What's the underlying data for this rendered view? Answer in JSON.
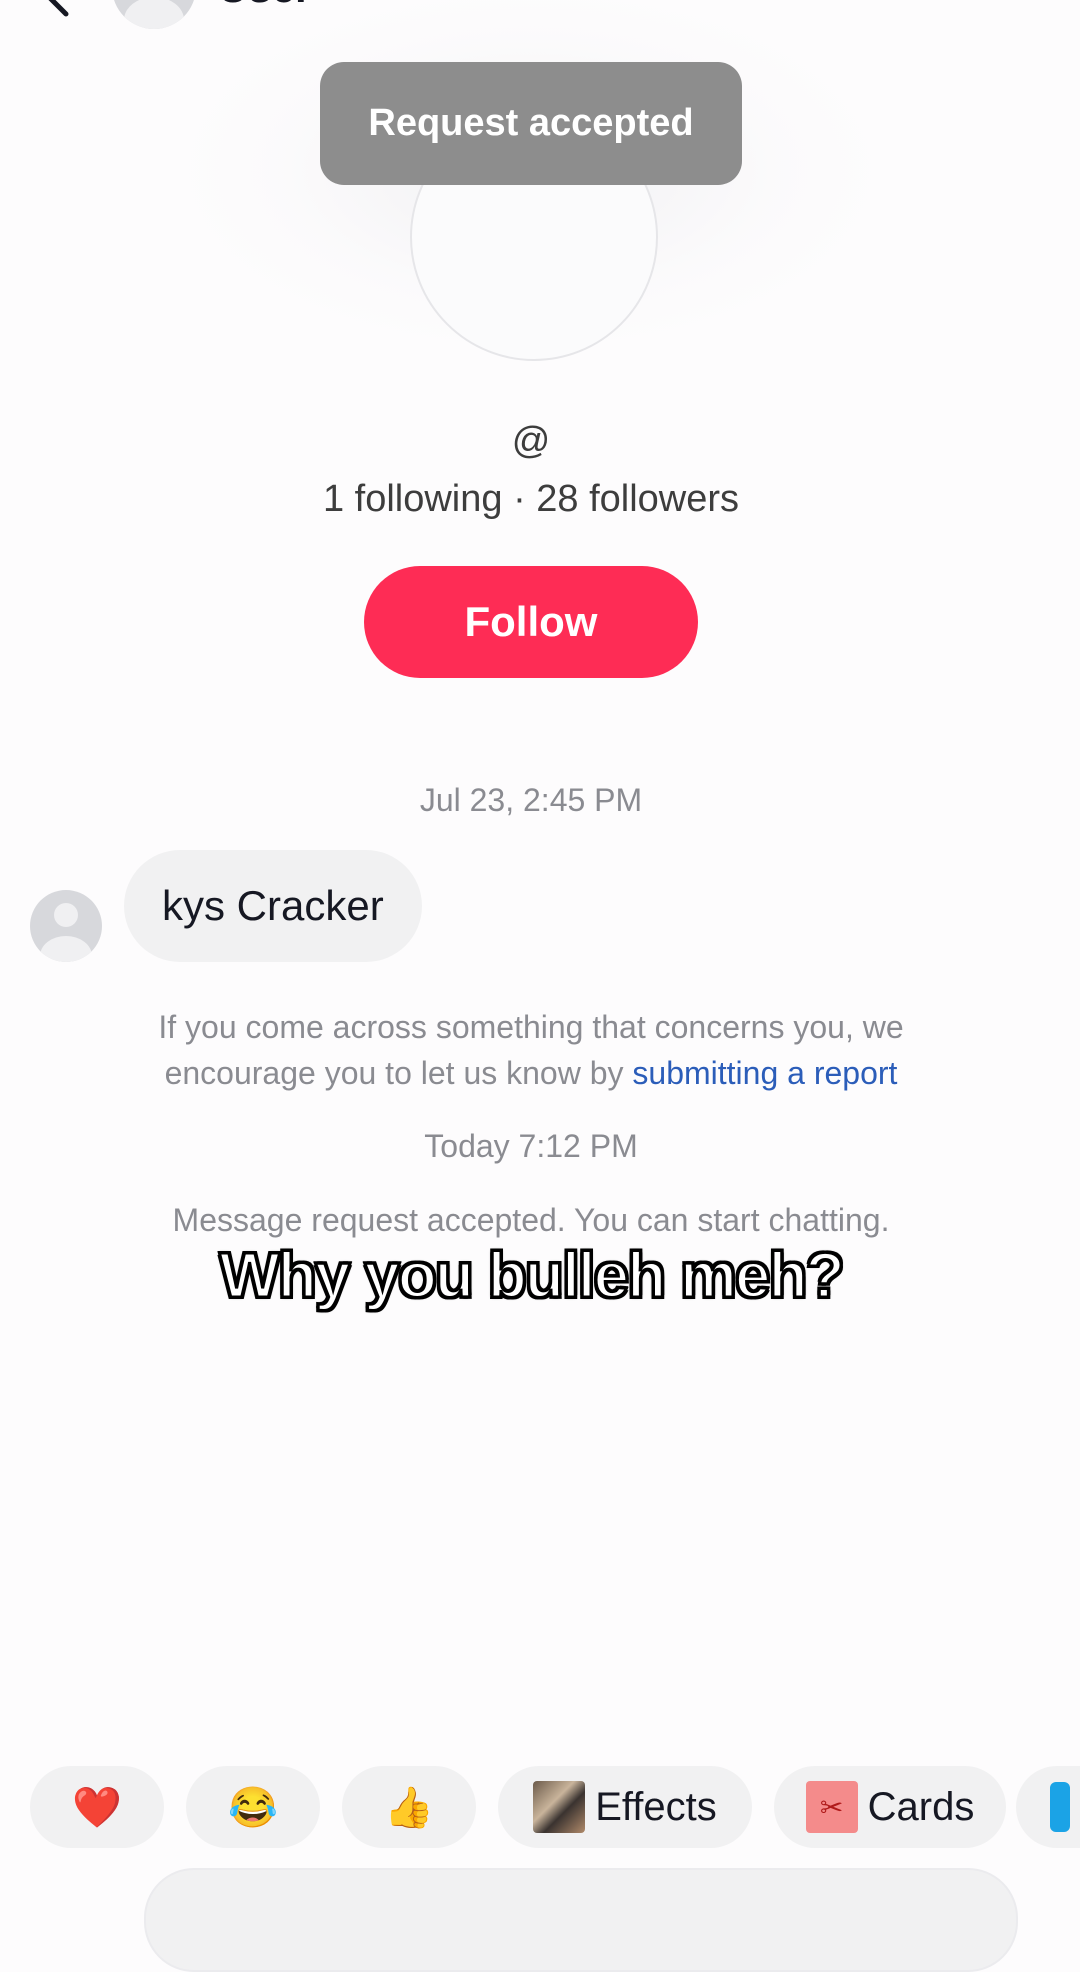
{
  "header": {
    "name": "User",
    "back_icon": "chevron-left-icon"
  },
  "toast": {
    "text": "Request accepted"
  },
  "profile": {
    "handle": "@",
    "stats": "1 following · 28 followers",
    "follow_label": "Follow"
  },
  "chat": {
    "timestamp_1": "Jul 23, 2:45 PM",
    "message_1": "kys Cracker",
    "notice_text": "If you come across something that concerns you, we encourage you to let us know by ",
    "notice_link": "submitting a report",
    "timestamp_2": "Today 7:12 PM",
    "system_message": "Message request accepted. You can start chatting."
  },
  "overlay_caption": "Why you bulleh meh?",
  "quick_replies": {
    "heart": "❤️",
    "laugh": "😂",
    "thumbs": "👍",
    "effects_label": "Effects",
    "cards_label": "Cards"
  },
  "colors": {
    "follow": "#fe2c55",
    "link": "#2b5db9",
    "toast": "#8d8d8d"
  }
}
